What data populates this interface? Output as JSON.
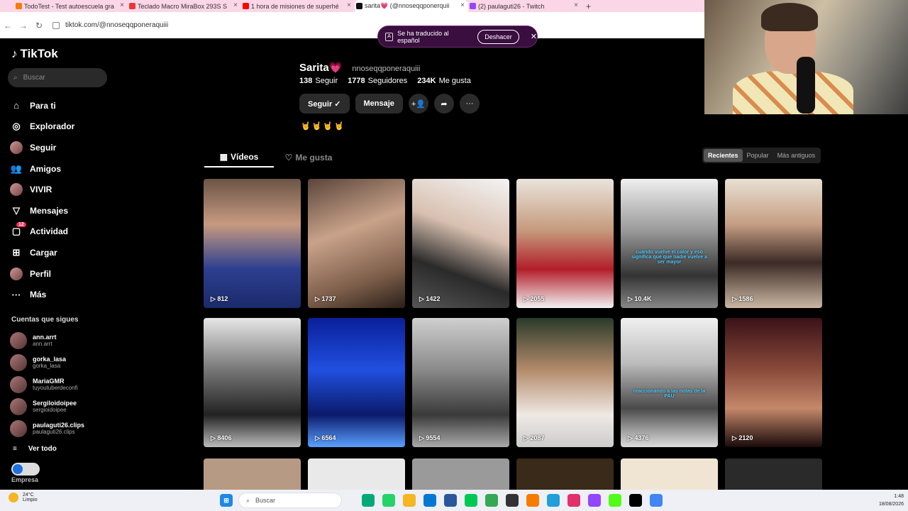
{
  "browser": {
    "tabs": [
      {
        "title": "TodoTest - Test autoescuela gra",
        "color": "#f57c00"
      },
      {
        "title": "Teclado Macro MiraBox 293S S",
        "color": "#e53935"
      },
      {
        "title": "1 hora de misiones de superhé",
        "color": "#ff0000"
      },
      {
        "title": "sarita💗 (@nnoseqqponerquii",
        "color": "#111111"
      },
      {
        "title": "(2) paulaguti26 - Twitch",
        "color": "#9146ff"
      }
    ],
    "active_tab": 3,
    "url": "tiktok.com/@nnoseqqponeraquiii"
  },
  "translate_bar": {
    "message": "Se ha traducido al español",
    "undo_label": "Deshacer"
  },
  "sidebar": {
    "logo": "TikTok",
    "search_placeholder": "Buscar",
    "menu": [
      {
        "label": "Para ti",
        "icon": "home-icon",
        "glyph": "⌂"
      },
      {
        "label": "Explorador",
        "icon": "compass-icon",
        "glyph": "◎"
      },
      {
        "label": "Seguir",
        "icon": "avatar",
        "glyph": ""
      },
      {
        "label": "Amigos",
        "icon": "friends-icon",
        "glyph": "👥"
      },
      {
        "label": "VIVIR",
        "icon": "avatar",
        "glyph": ""
      },
      {
        "label": "Mensajes",
        "icon": "send-icon",
        "glyph": "▽"
      },
      {
        "label": "Actividad",
        "icon": "inbox-icon",
        "glyph": "▢",
        "badge": "12"
      },
      {
        "label": "Cargar",
        "icon": "plus-icon",
        "glyph": "⊞"
      },
      {
        "label": "Perfil",
        "icon": "avatar",
        "glyph": ""
      },
      {
        "label": "Más",
        "icon": "more-icon",
        "glyph": "···"
      }
    ],
    "following_header": "Cuentas que sigues",
    "following": [
      {
        "name": "ann.arrt",
        "handle": "ann.arrt"
      },
      {
        "name": "gorka_lasa",
        "handle": "gorka_lasa"
      },
      {
        "name": "MariaGMR",
        "handle": "tuyoutuberdeconfi"
      },
      {
        "name": "Sergiloidoipee",
        "handle": "sergioidoipee"
      },
      {
        "name": "paulaguti26.clips",
        "handle": "paulaguti26.clips"
      }
    ],
    "see_all": "Ver todo",
    "business": "Empresa"
  },
  "profile": {
    "name": "Sarita💗",
    "username": "nnoseqqponeraquiii",
    "following_count": "138",
    "following_label": "Seguir",
    "followers_count": "1778",
    "followers_label": "Seguidores",
    "likes_count": "234K",
    "likes_label": "Me gusta",
    "follow_button": "Seguir ✓",
    "message_button": "Mensaje",
    "bio": "🤘🤘🤘🤘"
  },
  "tabs": {
    "videos": "Vídeos",
    "likes": "Me gusta",
    "sort": [
      "Recientes",
      "Popular",
      "Más antiguos"
    ],
    "sort_selected": 0
  },
  "videos": [
    {
      "views": "812",
      "bg": "linear-gradient(180deg,#6b5446 0%,#c79a80 35%,#2c3e8f 70%,#1b2a6b 100%)"
    },
    {
      "views": "1737",
      "bg": "linear-gradient(160deg,#5a463a 0%,#c9a28a 40%,#7d5e4a 75%,#2a1f18 100%)"
    },
    {
      "views": "1422",
      "bg": "linear-gradient(200deg,#f4f4f4 0%,#d8c0b0 40%,#2a2a2a 70%,#555 100%)"
    },
    {
      "views": "2055",
      "bg": "linear-gradient(180deg,#e9e4dc 0%,#c59a7c 40%,#b21e2a 70%,#f2f2f2 100%)"
    },
    {
      "views": "10.4K",
      "bg": "linear-gradient(180deg,#efefef 0%,#9a9a9a 40%,#333 75%,#888 100%)",
      "caption": "cuando vuelve el calor y eso significa que que nadie vuelve a ser mayor"
    },
    {
      "views": "1586",
      "bg": "linear-gradient(180deg,#e8e0d2 0%,#c69e84 35%,#3b2a25 65%,#cbb7a2 100%)"
    },
    {
      "views": "8406",
      "bg": "linear-gradient(180deg,#e6e6e6 0%,#777 40%,#222 75%,#bbb 100%)"
    },
    {
      "views": "6564",
      "bg": "linear-gradient(180deg,#0a1f9a 0%,#2050e0 40%,#0b1a6b 75%,#5aa0ff 100%)"
    },
    {
      "views": "9554",
      "bg": "linear-gradient(180deg,#cfcfcf 0%,#8a8a8a 40%,#3a3a3a 75%,#aaa 100%)"
    },
    {
      "views": "2087",
      "bg": "linear-gradient(180deg,#2a3b2a 0%,#b38a6a 40%,#efe9e4 75%,#ccc 100%)"
    },
    {
      "views": "4376",
      "bg": "linear-gradient(180deg,#f0f0f0 0%,#bcbcbc 35%,#4a4a4a 70%,#ddd 100%)",
      "caption": "reaccionando a las notas de la PAU"
    },
    {
      "views": "2120",
      "bg": "linear-gradient(180deg,#3a1218 0%,#8a4a3a 40%,#c4886a 70%,#1a0a0a 100%)"
    }
  ],
  "video_stubs": [
    "#b79a84",
    "#e9e9e9",
    "#9a9a9a",
    "#3a2a1a",
    "#efe5d2",
    "#2a2a2a"
  ],
  "taskbar": {
    "weather_temp": "24°C",
    "weather_desc": "Limpio",
    "search_placeholder": "Buscar",
    "apps": [
      "#1e88e5",
      "#0a7",
      "#25d366",
      "#f5b623",
      "#0078d4",
      "#2b579a",
      "#00c853",
      "#34a853",
      "#333",
      "#f57c00",
      "#229ed9",
      "#e1306c",
      "#9146ff",
      "#53fc18",
      "#000",
      "#4285f4"
    ],
    "time": "1:48",
    "date": "18/08/2026"
  }
}
